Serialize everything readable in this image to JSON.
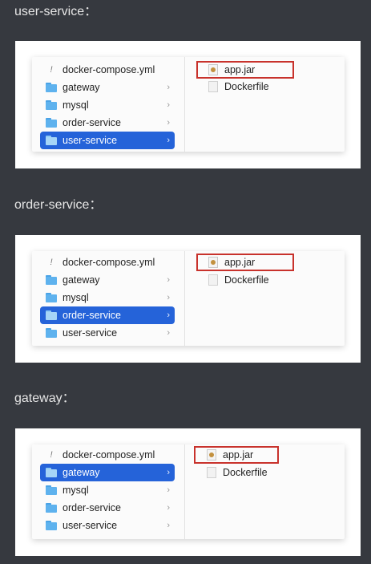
{
  "sections": [
    {
      "caption": "user-service：",
      "left_items": [
        {
          "label": "docker-compose.yml",
          "type": "file",
          "chevron": ""
        },
        {
          "label": "gateway",
          "type": "folder",
          "chevron": "›"
        },
        {
          "label": "mysql",
          "type": "folder",
          "chevron": "›"
        },
        {
          "label": "order-service",
          "type": "folder",
          "chevron": "›"
        },
        {
          "label": "user-service",
          "type": "folder",
          "chevron": "›",
          "selected": true
        }
      ],
      "right_items": [
        {
          "label": "app.jar",
          "type": "jar",
          "highlighted": true
        },
        {
          "label": "Dockerfile",
          "type": "file"
        }
      ]
    },
    {
      "caption": "order-service：",
      "left_items": [
        {
          "label": "docker-compose.yml",
          "type": "file",
          "chevron": ""
        },
        {
          "label": "gateway",
          "type": "folder",
          "chevron": "›"
        },
        {
          "label": "mysql",
          "type": "folder",
          "chevron": "›"
        },
        {
          "label": "order-service",
          "type": "folder",
          "chevron": "›",
          "selected": true
        },
        {
          "label": "user-service",
          "type": "folder",
          "chevron": "›"
        }
      ],
      "right_items": [
        {
          "label": "app.jar",
          "type": "jar",
          "highlighted": true
        },
        {
          "label": "Dockerfile",
          "type": "file"
        }
      ]
    },
    {
      "caption": "gateway：",
      "left_items": [
        {
          "label": "docker-compose.yml",
          "type": "file",
          "chevron": ""
        },
        {
          "label": "gateway",
          "type": "folder",
          "chevron": "›",
          "selected": true
        },
        {
          "label": "mysql",
          "type": "folder",
          "chevron": "›"
        },
        {
          "label": "order-service",
          "type": "folder",
          "chevron": "›"
        },
        {
          "label": "user-service",
          "type": "folder",
          "chevron": "›"
        }
      ],
      "right_items": [
        {
          "label": "app.jar",
          "type": "jar",
          "highlighted": true
        },
        {
          "label": "Dockerfile",
          "type": "file"
        }
      ]
    }
  ],
  "colors": {
    "page_background": "#36393f",
    "selection": "#2563d9",
    "highlight_border": "#c8322c",
    "folder": "#5eb2ee"
  }
}
